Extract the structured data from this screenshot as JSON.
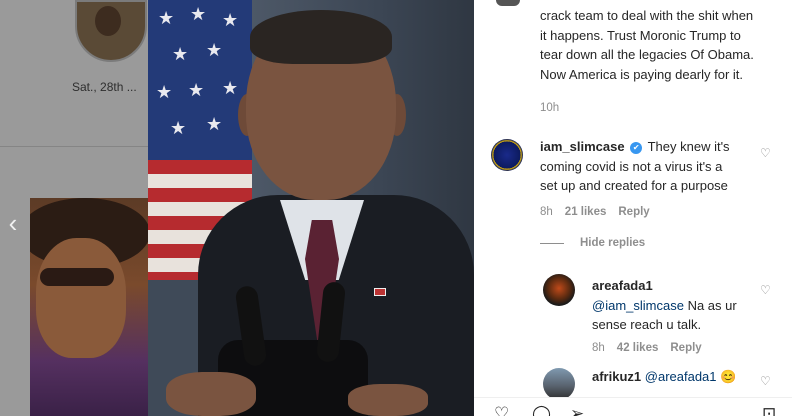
{
  "background_feed": {
    "date_label": "Sat., 28th ..."
  },
  "comments": [
    {
      "text_lines": [
        "crack team to deal with the shit when",
        "it happens. Trust Moronic Trump to",
        "tear down all the legacies Of Obama.",
        "Now America is paying dearly for it."
      ],
      "time": "10h"
    },
    {
      "username": "iam_slimcase",
      "verified": true,
      "text_first": "They knew it's",
      "text_lines": [
        "coming covid is not a virus it's a",
        "set up and created for a purpose"
      ],
      "time": "8h",
      "likes": "21 likes",
      "reply": "Reply"
    }
  ],
  "hide_replies_label": "Hide replies",
  "replies": [
    {
      "username": "areafada1",
      "mention": "@iam_slimcase",
      "text_first": " Na as ur",
      "text_lines": [
        "sense reach u talk."
      ],
      "time": "8h",
      "likes": "42 likes",
      "reply": "Reply"
    },
    {
      "username": "afrikuz1",
      "mention": "@areafada1",
      "emoji": "😊"
    }
  ],
  "icons": [
    "chevron-left-icon",
    "heart-icon",
    "comment-icon",
    "share-icon",
    "bookmark-icon",
    "verified-icon"
  ],
  "colors": {
    "panel_bg": "#ffffff",
    "text": "#262626",
    "secondary_text": "#8e8e8e",
    "mention": "#00376b",
    "verified": "#3897f0",
    "overlay": "#8f8f8f"
  }
}
